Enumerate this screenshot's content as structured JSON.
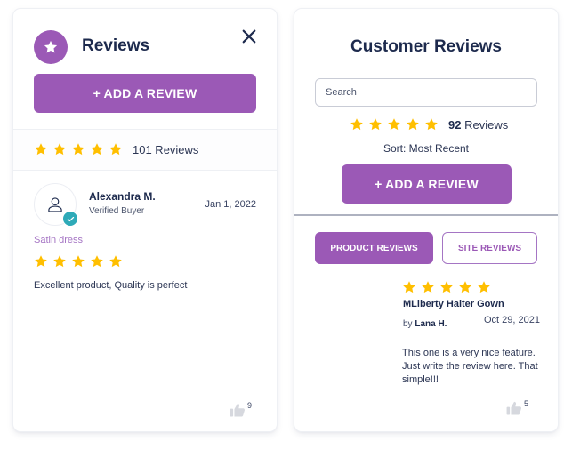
{
  "colors": {
    "accent": "#9b59b6",
    "star": "#ffbf00",
    "text_dark": "#1d2a4d",
    "verified_badge": "#2eaab8",
    "product_link": "#a575c4"
  },
  "left_widget": {
    "title": "Reviews",
    "badge_icon": "star-icon",
    "close_icon": "close-icon",
    "add_review_label": "+ ADD A REVIEW",
    "rating": {
      "stars": 5,
      "max": 5,
      "count_label": "101 Reviews"
    },
    "review": {
      "author": "Alexandra M.",
      "author_status": "Verified Buyer",
      "date": "Jan 1, 2022",
      "product": "Satin dress",
      "stars": 5,
      "text": "Excellent product, Quality is perfect",
      "likes": "9"
    }
  },
  "right_widget": {
    "title": "Customer Reviews",
    "search": {
      "placeholder": "Search",
      "value": ""
    },
    "rating": {
      "stars": 5,
      "max": 5,
      "count": "92",
      "count_suffix": " Reviews"
    },
    "sort_label": "Sort: Most Recent",
    "add_review_label": "+ ADD A REVIEW",
    "tabs": [
      {
        "label": "PRODUCT REVIEWS",
        "active": true
      },
      {
        "label": "SITE REVIEWS",
        "active": false
      }
    ],
    "review": {
      "stars": 5,
      "product": "MLiberty Halter Gown",
      "by_prefix": "by ",
      "author": "Lana H.",
      "date": "Oct 29, 2021",
      "text": "This one is a very nice feature. Just write the review here. That simple!!!",
      "likes": "5"
    }
  }
}
